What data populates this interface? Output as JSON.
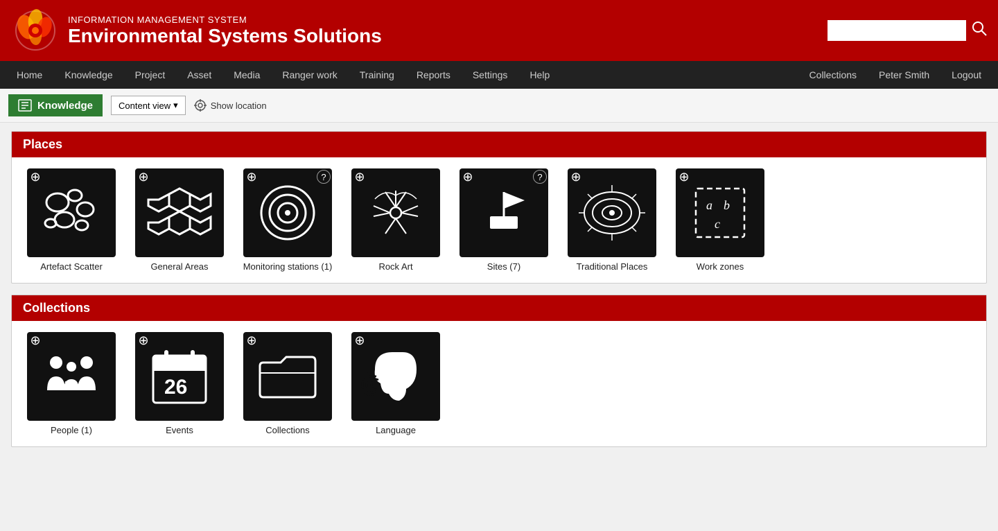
{
  "header": {
    "subtitle": "INFORMATION MANAGEMENT SYSTEM",
    "title": "Environmental Systems Solutions",
    "search_placeholder": "",
    "search_icon": "search-icon"
  },
  "nav": {
    "items": [
      {
        "label": "Home",
        "id": "home"
      },
      {
        "label": "Knowledge",
        "id": "knowledge"
      },
      {
        "label": "Project",
        "id": "project"
      },
      {
        "label": "Asset",
        "id": "asset"
      },
      {
        "label": "Media",
        "id": "media"
      },
      {
        "label": "Ranger work",
        "id": "ranger-work"
      },
      {
        "label": "Training",
        "id": "training"
      },
      {
        "label": "Reports",
        "id": "reports"
      },
      {
        "label": "Settings",
        "id": "settings"
      },
      {
        "label": "Help",
        "id": "help"
      }
    ],
    "right_items": [
      {
        "label": "Collections",
        "id": "collections"
      },
      {
        "label": "Peter Smith",
        "id": "peter-smith"
      },
      {
        "label": "Logout",
        "id": "logout"
      }
    ]
  },
  "toolbar": {
    "knowledge_label": "Knowledge",
    "content_view_label": "Content view",
    "show_location_label": "Show location"
  },
  "places": {
    "section_title": "Places",
    "cards": [
      {
        "id": "artefact-scatter",
        "label": "Artefact Scatter",
        "has_help": false
      },
      {
        "id": "general-areas",
        "label": "General Areas",
        "has_help": false
      },
      {
        "id": "monitoring-stations",
        "label": "Monitoring stations (1)",
        "has_help": true
      },
      {
        "id": "rock-art",
        "label": "Rock Art",
        "has_help": false
      },
      {
        "id": "sites",
        "label": "Sites (7)",
        "has_help": true
      },
      {
        "id": "traditional-places",
        "label": "Traditional Places",
        "has_help": false
      },
      {
        "id": "work-zones",
        "label": "Work zones",
        "has_help": false
      }
    ]
  },
  "collections": {
    "section_title": "Collections",
    "cards": [
      {
        "id": "people",
        "label": "People (1)",
        "has_help": false
      },
      {
        "id": "events",
        "label": "Events",
        "has_help": false
      },
      {
        "id": "collections",
        "label": "Collections",
        "has_help": false
      },
      {
        "id": "language",
        "label": "Language",
        "has_help": false
      }
    ]
  },
  "colors": {
    "brand_red": "#b30000",
    "nav_dark": "#222222",
    "knowledge_green": "#2e7d32",
    "card_black": "#111111"
  }
}
